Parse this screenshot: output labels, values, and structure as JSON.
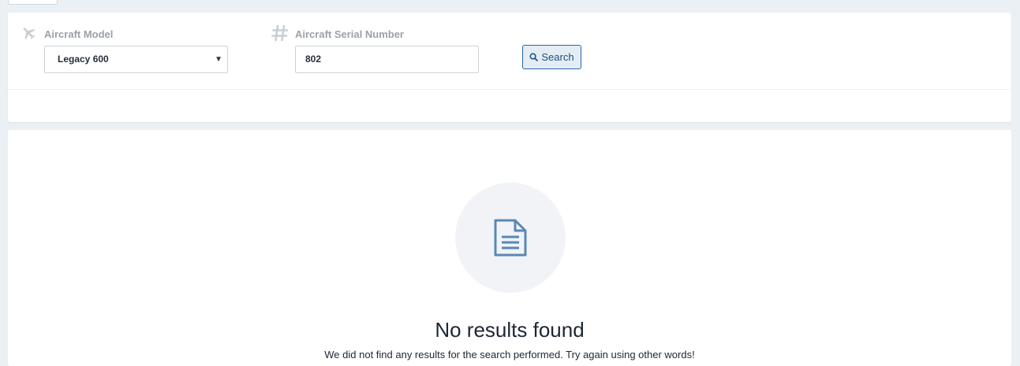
{
  "filters": {
    "model": {
      "icon": "plane-icon",
      "label": "Aircraft Model",
      "selected": "Legacy 600"
    },
    "serial": {
      "icon": "hash-icon",
      "label": "Aircraft Serial Number",
      "value": "802"
    },
    "search_label": "Search"
  },
  "results": {
    "icon": "document-icon",
    "title": "No results found",
    "description": "We did not find any results for the search performed. Try again using other words!"
  },
  "colors": {
    "background": "#ebf0f4",
    "accent": "#2a67a8",
    "icon_muted": "#c9ced4",
    "document_icon": "#5b87b6"
  }
}
